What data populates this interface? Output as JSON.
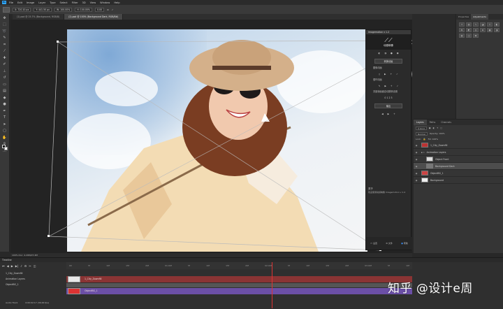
{
  "menubar": {
    "app_badge": "Ps",
    "items": [
      "File",
      "Edit",
      "Image",
      "Layer",
      "Type",
      "Select",
      "Filter",
      "3D",
      "View",
      "Window",
      "Help"
    ]
  },
  "options": {
    "x_value": "X: 720.10 px",
    "w_value": "W: 100.00%",
    "y_value": "Y: 441.50 px",
    "h_value": "H: 100.00%",
    "angle_value": "0.00"
  },
  "document_tabs": [
    {
      "label": "(1).psd @ 25.7% (Background, RGB/8)"
    },
    {
      "label": "(2).psd @ 100% (Background Dark, RGB/8#)",
      "active": true
    }
  ],
  "plugin": {
    "title": "Imagemotion v 1.2",
    "logo_text": "动感映像",
    "section_play": "转换动画",
    "label_speed": "图像动画",
    "label_loop": "循环动画",
    "label_frames": "关键帧画面自动跳转设置",
    "label_frames_values": "0  1  2  3",
    "btn_export": "输出",
    "about_title": "关于",
    "about_text": "欢迎使用动感映像 Imagemotion v 1.2",
    "foot": [
      "设置",
      "文件",
      "帮助"
    ]
  },
  "right_panel": {
    "tabs": [
      "Properties",
      "Adjustments"
    ],
    "active": "Adjustments"
  },
  "layers_panel": {
    "tabs": [
      "Layers",
      "Paths",
      "Channels"
    ],
    "blend_mode": "Normal",
    "opacity": "Opacity: 100%",
    "fill": "Fill: 100%",
    "layers": [
      {
        "name": "1_City_Zoomfill",
        "visible": true,
        "indent": false,
        "selected": false
      },
      {
        "name": "Animation Layers",
        "visible": true,
        "indent": false,
        "selected": false
      },
      {
        "name": "Object Front",
        "visible": true,
        "indent": true,
        "selected": false
      },
      {
        "name": "Background Dark",
        "visible": true,
        "indent": true,
        "selected": true
      },
      {
        "name": "ObjectBG_1",
        "visible": true,
        "indent": false,
        "selected": false
      },
      {
        "name": "Background",
        "visible": true,
        "indent": false,
        "selected": false
      }
    ]
  },
  "status": {
    "text": "100%    Doc: 4.29M/27.4M"
  },
  "timeline": {
    "title": "Timeline",
    "ruler": [
      "00",
      "5f",
      "10f",
      "15f",
      "20f",
      "01:00f",
      "5f",
      "10f",
      "15f",
      "20f",
      "02:00f",
      "5f",
      "10f",
      "15f",
      "20f",
      "03:00f",
      "5f",
      "10f"
    ],
    "tracks": [
      "1_City_Zoomfill",
      "Animation Layers",
      "ObjectBG_1"
    ],
    "clip_red_label": "1_City_Zoomfill",
    "clip_purple_label": "ObjectBG_1",
    "footer": "0:00:02:17   (30.00 fps)",
    "audio_label": "Audio Track"
  },
  "watermark": "知乎 @设计e周"
}
